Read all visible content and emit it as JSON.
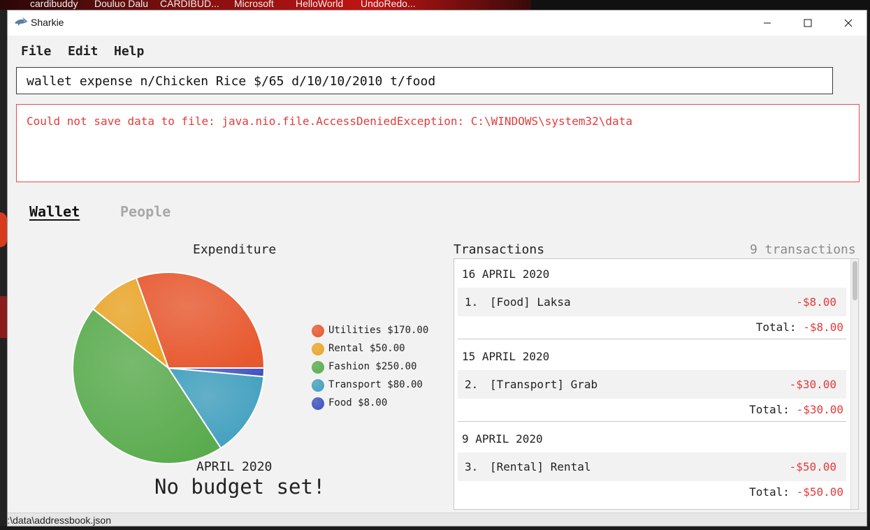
{
  "taskbar": {
    "items": [
      "cardibuddy",
      "Douluo Dalu",
      "CARDIBUD...",
      "Microsoft",
      "HelloWorld",
      "UndoRedo..."
    ]
  },
  "window": {
    "title": "Sharkie"
  },
  "menu": {
    "file": "File",
    "edit": "Edit",
    "help": "Help"
  },
  "command": {
    "value": "wallet expense n/Chicken Rice $/65 d/10/10/2010 t/food"
  },
  "result": {
    "message": "Could not save data to file: java.nio.file.AccessDeniedException: C:\\WINDOWS\\system32\\data"
  },
  "tabs": {
    "wallet": "Wallet",
    "people": "People"
  },
  "expenditure": {
    "title": "Expenditure",
    "month": "APRIL 2020",
    "budget": "No budget set!"
  },
  "chart_data": {
    "type": "pie",
    "title": "Expenditure",
    "categories": [
      "Utilities",
      "Rental",
      "Fashion",
      "Transport",
      "Food"
    ],
    "values": [
      170.0,
      50.0,
      250.0,
      80.0,
      8.0
    ],
    "legend_labels": [
      "Utilities $170.00",
      "Rental $50.00",
      "Fashion $250.00",
      "Transport $80.00",
      "Food $8.00"
    ],
    "colors": [
      "#e8582e",
      "#eaa526",
      "#59ab4d",
      "#3f9fbe",
      "#3d4fbf"
    ],
    "legend_position": "right"
  },
  "transactions": {
    "title": "Transactions",
    "count": "9 transactions",
    "groups": [
      {
        "date": "16 APRIL 2020",
        "index": "1.",
        "desc": "[Food] Laksa",
        "amount": "-$8.00",
        "total_label": "Total:",
        "total": "-$8.00"
      },
      {
        "date": "15 APRIL 2020",
        "index": "2.",
        "desc": "[Transport] Grab",
        "amount": "-$30.00",
        "total_label": "Total:",
        "total": "-$30.00"
      },
      {
        "date": "9 APRIL 2020",
        "index": "3.",
        "desc": "[Rental] Rental",
        "amount": "-$50.00",
        "total_label": "Total:",
        "total": "-$50.00"
      }
    ]
  },
  "status": {
    "path": "S:\\data\\addressbook.json"
  }
}
